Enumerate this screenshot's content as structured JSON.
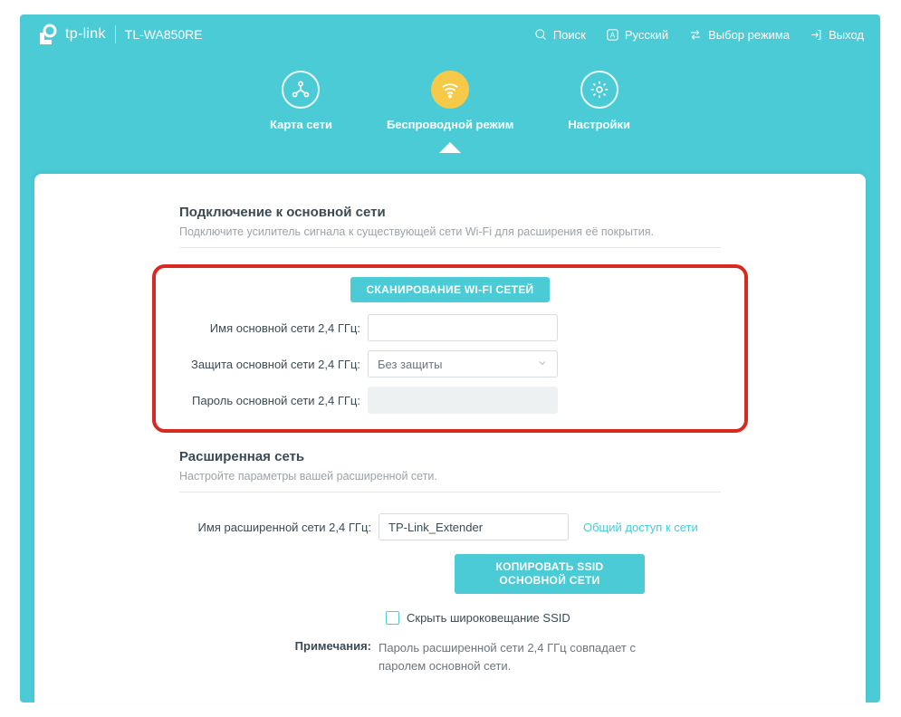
{
  "brand": "tp-link",
  "model": "TL-WA850RE",
  "top_links": {
    "search": "Поиск",
    "language": "Русский",
    "mode": "Выбор режима",
    "logout": "Выход"
  },
  "nav": {
    "map": "Карта сети",
    "wireless": "Беспроводной режим",
    "settings": "Настройки"
  },
  "host": {
    "title": "Подключение к основной сети",
    "subtitle": "Подключите усилитель сигнала к существующей сети Wi-Fi для расширения её покрытия.",
    "scan_btn": "СКАНИРОВАНИЕ WI-FI СЕТЕЙ",
    "ssid_label": "Имя основной сети 2,4 ГГц:",
    "ssid_value": "",
    "security_label": "Защита основной сети 2,4 ГГц:",
    "security_value": "Без защиты",
    "password_label": "Пароль основной сети 2,4 ГГц:",
    "password_value": ""
  },
  "ext": {
    "title": "Расширенная сеть",
    "subtitle": "Настройте параметры вашей расширенной сети.",
    "ssid_label": "Имя расширенной сети 2,4 ГГц:",
    "ssid_value": "TP-Link_Extender",
    "share_link": "Общий доступ к сети",
    "copy_btn": "КОПИРОВАТЬ SSID ОСНОВНОЙ СЕТИ",
    "hide_label": "Скрыть широковещание SSID",
    "note_label": "Примечания:",
    "note_text": "Пароль расширенной сети 2,4 ГГц совпадает с паролем основной сети."
  }
}
